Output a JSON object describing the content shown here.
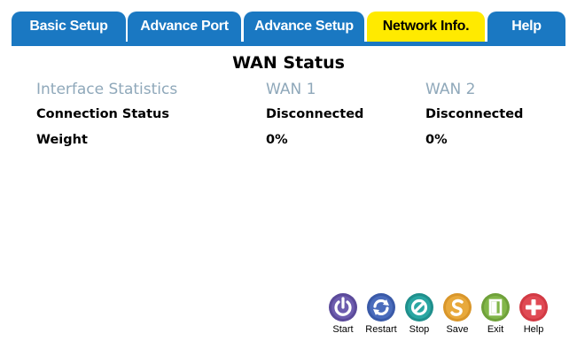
{
  "tabs": [
    {
      "label": "Basic Setup"
    },
    {
      "label": "Advance Port"
    },
    {
      "label": "Advance Setup"
    },
    {
      "label": "Network Info."
    },
    {
      "label": "Help"
    }
  ],
  "active_tab": "Network Info.",
  "title": "WAN Status",
  "table": {
    "headers": [
      "Interface Statistics",
      "WAN 1",
      "WAN 2"
    ],
    "rows": [
      {
        "label": "Connection Status",
        "wan1": "Disconnected",
        "wan2": "Disconnected"
      },
      {
        "label": "Weight",
        "wan1": "0%",
        "wan2": "0%"
      }
    ]
  },
  "toolbar": {
    "buttons": [
      {
        "label": "Start",
        "icon": "power-icon",
        "color": "#5b4a9a"
      },
      {
        "label": "Restart",
        "icon": "restart-icon",
        "color": "#3a5aa8"
      },
      {
        "label": "Stop",
        "icon": "stop-icon",
        "color": "#1f8f8c"
      },
      {
        "label": "Save",
        "icon": "save-icon",
        "color": "#d9962a"
      },
      {
        "label": "Exit",
        "icon": "exit-icon",
        "color": "#6fa13a"
      },
      {
        "label": "Help",
        "icon": "help-plus-icon",
        "color": "#d23a44"
      }
    ]
  },
  "colors": {
    "tab_blue": "#1a78c2",
    "tab_active": "#ffea00",
    "header_text": "#8fa8ba"
  }
}
